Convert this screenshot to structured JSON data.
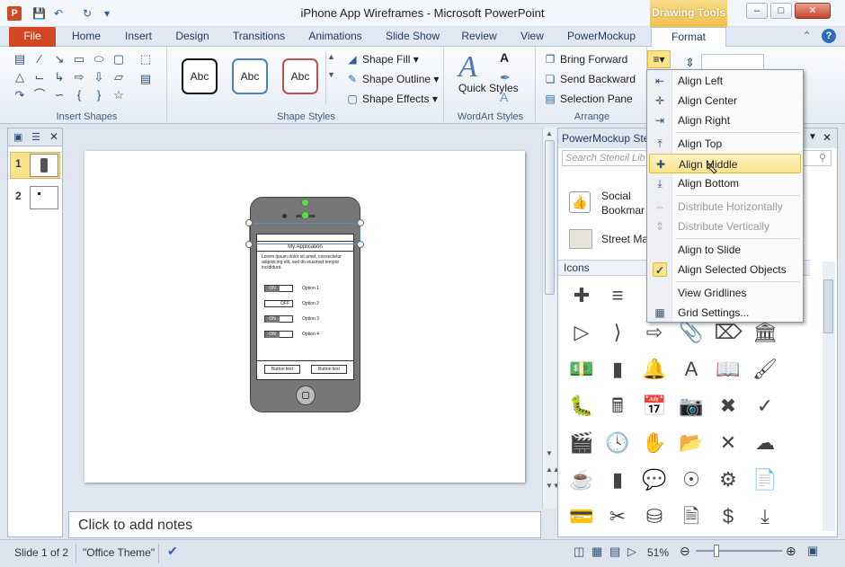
{
  "window": {
    "title": "iPhone App Wireframes - Microsoft PowerPoint",
    "context_tab": "Drawing Tools",
    "controls": [
      "–",
      "□",
      "✕"
    ]
  },
  "ribbon": {
    "tabs": [
      "File",
      "Home",
      "Insert",
      "Design",
      "Transitions",
      "Animations",
      "Slide Show",
      "Review",
      "View",
      "PowerMockup",
      "Format"
    ],
    "groups": {
      "insert_shapes": "Insert Shapes",
      "shape_styles": "Shape Styles",
      "wordart_styles": "WordArt Styles",
      "arrange": "Arrange"
    },
    "style_samples": [
      "Abc",
      "Abc",
      "Abc"
    ],
    "shape_fill": "Shape Fill",
    "shape_outline": "Shape Outline",
    "shape_effects": "Shape Effects",
    "quick_styles": "Quick Styles",
    "bring_forward": "Bring Forward",
    "send_backward": "Send Backward",
    "selection_pane": "Selection Pane"
  },
  "slides": [
    "1",
    "2"
  ],
  "notes_placeholder": "Click to add notes",
  "stencil": {
    "title": "PowerMockup Ste",
    "search_placeholder": "Search Stencil Lib",
    "items": [
      "Social Bookmar",
      "Street Ma"
    ],
    "section": "Icons"
  },
  "mockup": {
    "app_title": "My Application",
    "lorem": "Lorem ipsum dolor sit amet, consectetur adipisicing elit, sed do eiusmod tempor incididunt.",
    "toggles": [
      {
        "state": "ON",
        "label": "Option 1"
      },
      {
        "state": "OFF",
        "label": "Option 2"
      },
      {
        "state": "ON",
        "label": "Option 3"
      },
      {
        "state": "ON",
        "label": "Option 4"
      }
    ],
    "buttons": [
      "Button text",
      "Button text"
    ]
  },
  "align_menu": {
    "items": [
      {
        "label": "Align Left",
        "icon": "align-left-icon",
        "disabled": false
      },
      {
        "label": "Align Center",
        "icon": "align-center-icon",
        "disabled": false
      },
      {
        "label": "Align Right",
        "icon": "align-right-icon",
        "disabled": false
      },
      {
        "label": "Align Top",
        "icon": "align-top-icon",
        "disabled": false
      },
      {
        "label": "Align Middle",
        "icon": "align-middle-icon",
        "disabled": false,
        "highlighted": true
      },
      {
        "label": "Align Bottom",
        "icon": "align-bottom-icon",
        "disabled": false
      },
      {
        "label": "Distribute Horizontally",
        "icon": "distribute-horizontally-icon",
        "disabled": true
      },
      {
        "label": "Distribute Vertically",
        "icon": "distribute-vertically-icon",
        "disabled": true
      },
      {
        "label": "Align to Slide",
        "icon": "",
        "disabled": false
      },
      {
        "label": "Align Selected Objects",
        "icon": "checkmark-icon",
        "disabled": false,
        "checked": true
      },
      {
        "label": "View Gridlines",
        "icon": "",
        "disabled": false
      },
      {
        "label": "Grid Settings...",
        "icon": "grid-icon",
        "disabled": false
      }
    ]
  },
  "status": {
    "slide": "Slide 1 of 2",
    "theme": "\"Office Theme\"",
    "zoom": "51%"
  },
  "colors": {
    "file_tab": "#d24726",
    "drawing_tools": "#f0c14f",
    "menu_highlight": "#fbe38b"
  }
}
